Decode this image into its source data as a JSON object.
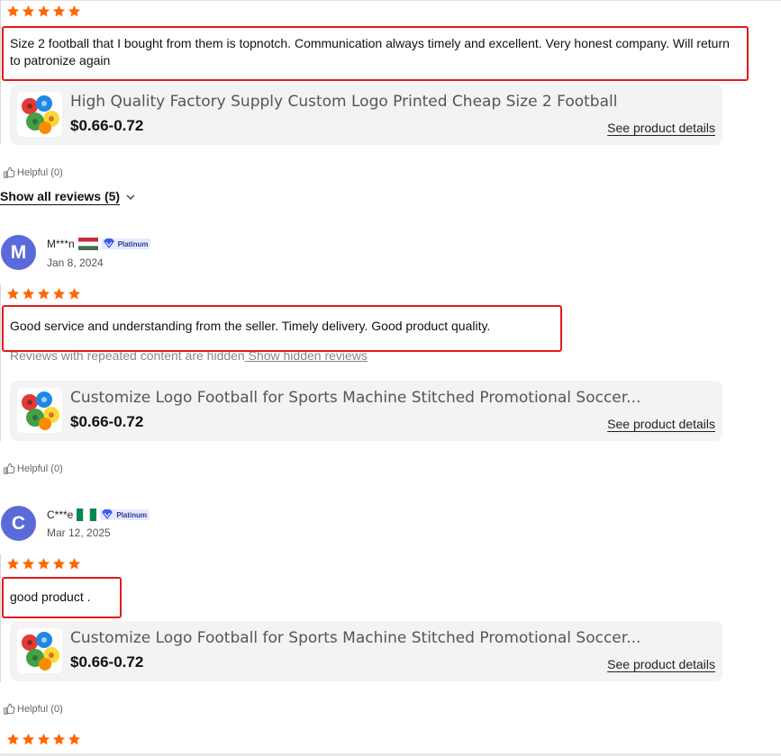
{
  "colors": {
    "star": "#ff6600",
    "highlight_box": "#e11b1b",
    "avatar_bg": "#5b6ad9",
    "card_bg": "#f3f3f3",
    "badge_bg": "#e6eaff"
  },
  "rating_stars": 5,
  "show_all": {
    "label": "Show all reviews (5)",
    "icon": "chevron-down-icon"
  },
  "hidden_notice": {
    "text": "Reviews with repeated content are hidden",
    "link": " Show hidden reviews"
  },
  "reviews": [
    {
      "text": "Size 2 football that I bought from them is topnotch. Communication always timely and excellent. Very honest company. Will return to patronize again",
      "product": {
        "title": "High Quality Factory Supply Custom Logo Printed Cheap Size 2 Football",
        "price": "$0.66-0.72",
        "link": "See product details"
      },
      "helpful": "Helpful (0)"
    },
    {
      "avatar_letter": "M",
      "name": "M***n",
      "flag": "hungary-flag",
      "badge": "Platinum",
      "date": "Jan 8, 2024",
      "text": "Good service and understanding from the seller. Timely delivery. Good product quality.",
      "product": {
        "title": "Customize Logo Football for Sports Machine Stitched Promotional Soccer...",
        "price": "$0.66-0.72",
        "link": "See product details"
      },
      "helpful": "Helpful (0)"
    },
    {
      "avatar_letter": "C",
      "name": "C***e",
      "flag": "nigeria-flag",
      "badge": "Platinum",
      "date": "Mar 12, 2025",
      "text": "good product .",
      "product": {
        "title": "Customize Logo Football for Sports Machine Stitched Promotional Soccer...",
        "price": "$0.66-0.72",
        "link": "See product details"
      },
      "helpful": "Helpful (0)"
    }
  ]
}
